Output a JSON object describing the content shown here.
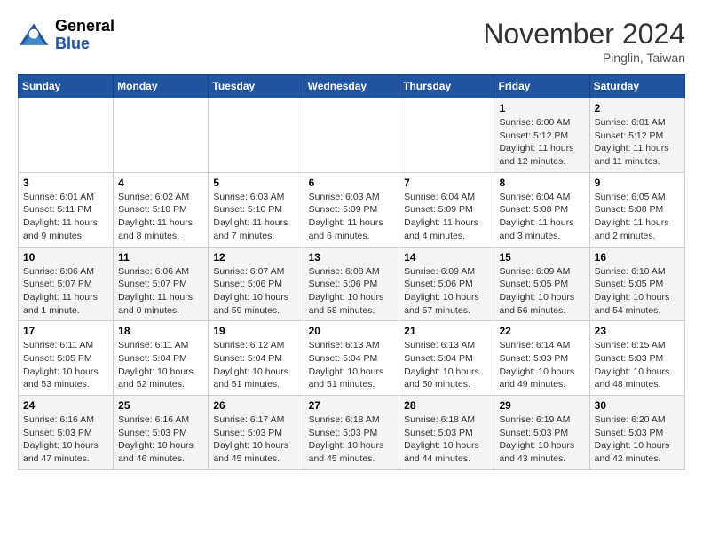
{
  "header": {
    "logo_line1": "General",
    "logo_line2": "Blue",
    "month_title": "November 2024",
    "location": "Pinglin, Taiwan"
  },
  "days_of_week": [
    "Sunday",
    "Monday",
    "Tuesday",
    "Wednesday",
    "Thursday",
    "Friday",
    "Saturday"
  ],
  "weeks": [
    [
      {
        "day": "",
        "info": ""
      },
      {
        "day": "",
        "info": ""
      },
      {
        "day": "",
        "info": ""
      },
      {
        "day": "",
        "info": ""
      },
      {
        "day": "",
        "info": ""
      },
      {
        "day": "1",
        "info": "Sunrise: 6:00 AM\nSunset: 5:12 PM\nDaylight: 11 hours and 12 minutes."
      },
      {
        "day": "2",
        "info": "Sunrise: 6:01 AM\nSunset: 5:12 PM\nDaylight: 11 hours and 11 minutes."
      }
    ],
    [
      {
        "day": "3",
        "info": "Sunrise: 6:01 AM\nSunset: 5:11 PM\nDaylight: 11 hours and 9 minutes."
      },
      {
        "day": "4",
        "info": "Sunrise: 6:02 AM\nSunset: 5:10 PM\nDaylight: 11 hours and 8 minutes."
      },
      {
        "day": "5",
        "info": "Sunrise: 6:03 AM\nSunset: 5:10 PM\nDaylight: 11 hours and 7 minutes."
      },
      {
        "day": "6",
        "info": "Sunrise: 6:03 AM\nSunset: 5:09 PM\nDaylight: 11 hours and 6 minutes."
      },
      {
        "day": "7",
        "info": "Sunrise: 6:04 AM\nSunset: 5:09 PM\nDaylight: 11 hours and 4 minutes."
      },
      {
        "day": "8",
        "info": "Sunrise: 6:04 AM\nSunset: 5:08 PM\nDaylight: 11 hours and 3 minutes."
      },
      {
        "day": "9",
        "info": "Sunrise: 6:05 AM\nSunset: 5:08 PM\nDaylight: 11 hours and 2 minutes."
      }
    ],
    [
      {
        "day": "10",
        "info": "Sunrise: 6:06 AM\nSunset: 5:07 PM\nDaylight: 11 hours and 1 minute."
      },
      {
        "day": "11",
        "info": "Sunrise: 6:06 AM\nSunset: 5:07 PM\nDaylight: 11 hours and 0 minutes."
      },
      {
        "day": "12",
        "info": "Sunrise: 6:07 AM\nSunset: 5:06 PM\nDaylight: 10 hours and 59 minutes."
      },
      {
        "day": "13",
        "info": "Sunrise: 6:08 AM\nSunset: 5:06 PM\nDaylight: 10 hours and 58 minutes."
      },
      {
        "day": "14",
        "info": "Sunrise: 6:09 AM\nSunset: 5:06 PM\nDaylight: 10 hours and 57 minutes."
      },
      {
        "day": "15",
        "info": "Sunrise: 6:09 AM\nSunset: 5:05 PM\nDaylight: 10 hours and 56 minutes."
      },
      {
        "day": "16",
        "info": "Sunrise: 6:10 AM\nSunset: 5:05 PM\nDaylight: 10 hours and 54 minutes."
      }
    ],
    [
      {
        "day": "17",
        "info": "Sunrise: 6:11 AM\nSunset: 5:05 PM\nDaylight: 10 hours and 53 minutes."
      },
      {
        "day": "18",
        "info": "Sunrise: 6:11 AM\nSunset: 5:04 PM\nDaylight: 10 hours and 52 minutes."
      },
      {
        "day": "19",
        "info": "Sunrise: 6:12 AM\nSunset: 5:04 PM\nDaylight: 10 hours and 51 minutes."
      },
      {
        "day": "20",
        "info": "Sunrise: 6:13 AM\nSunset: 5:04 PM\nDaylight: 10 hours and 51 minutes."
      },
      {
        "day": "21",
        "info": "Sunrise: 6:13 AM\nSunset: 5:04 PM\nDaylight: 10 hours and 50 minutes."
      },
      {
        "day": "22",
        "info": "Sunrise: 6:14 AM\nSunset: 5:03 PM\nDaylight: 10 hours and 49 minutes."
      },
      {
        "day": "23",
        "info": "Sunrise: 6:15 AM\nSunset: 5:03 PM\nDaylight: 10 hours and 48 minutes."
      }
    ],
    [
      {
        "day": "24",
        "info": "Sunrise: 6:16 AM\nSunset: 5:03 PM\nDaylight: 10 hours and 47 minutes."
      },
      {
        "day": "25",
        "info": "Sunrise: 6:16 AM\nSunset: 5:03 PM\nDaylight: 10 hours and 46 minutes."
      },
      {
        "day": "26",
        "info": "Sunrise: 6:17 AM\nSunset: 5:03 PM\nDaylight: 10 hours and 45 minutes."
      },
      {
        "day": "27",
        "info": "Sunrise: 6:18 AM\nSunset: 5:03 PM\nDaylight: 10 hours and 45 minutes."
      },
      {
        "day": "28",
        "info": "Sunrise: 6:18 AM\nSunset: 5:03 PM\nDaylight: 10 hours and 44 minutes."
      },
      {
        "day": "29",
        "info": "Sunrise: 6:19 AM\nSunset: 5:03 PM\nDaylight: 10 hours and 43 minutes."
      },
      {
        "day": "30",
        "info": "Sunrise: 6:20 AM\nSunset: 5:03 PM\nDaylight: 10 hours and 42 minutes."
      }
    ]
  ]
}
